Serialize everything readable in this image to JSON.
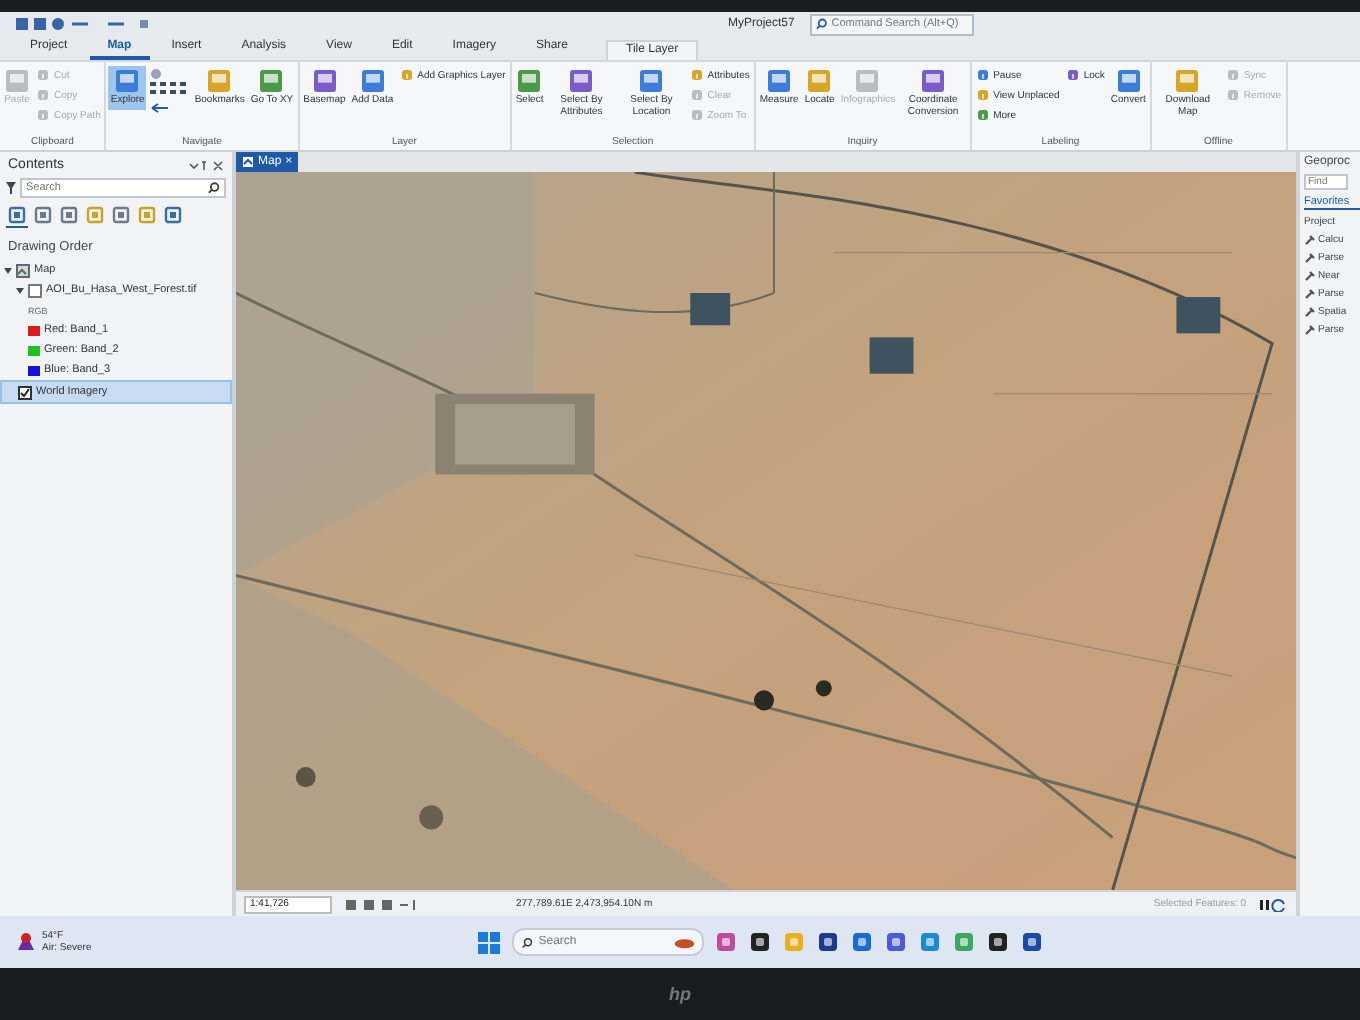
{
  "title_bar": {
    "project": "MyProject57",
    "search": {
      "placeholder": "Command Search (Alt+Q)"
    }
  },
  "tabs": [
    {
      "label": "Project",
      "selected": false,
      "kind": "file"
    },
    {
      "label": "Map",
      "selected": true,
      "kind": "tab"
    },
    {
      "label": "Insert",
      "selected": false,
      "kind": "tab"
    },
    {
      "label": "Analysis",
      "selected": false,
      "kind": "tab"
    },
    {
      "label": "View",
      "selected": false,
      "kind": "tab"
    },
    {
      "label": "Edit",
      "selected": false,
      "kind": "tab"
    },
    {
      "label": "Imagery",
      "selected": false,
      "kind": "tab"
    },
    {
      "label": "Share",
      "selected": false,
      "kind": "tab"
    },
    {
      "label": "Tile Layer",
      "selected": false,
      "kind": "context"
    }
  ],
  "ribbon": [
    {
      "label": "Clipboard",
      "items": [
        {
          "kind": "large",
          "label": "Paste",
          "disabled": true,
          "pressed": false
        },
        {
          "kind": "stack",
          "items": [
            {
              "label": "Cut",
              "disabled": true
            },
            {
              "label": "Copy",
              "disabled": true
            },
            {
              "label": "Copy Path",
              "disabled": true
            }
          ]
        }
      ]
    },
    {
      "label": "Navigate",
      "items": [
        {
          "kind": "large",
          "label": "Explore",
          "disabled": false,
          "pressed": true
        },
        {
          "kind": "grid"
        },
        {
          "kind": "large",
          "label": "Bookmarks",
          "disabled": false,
          "pressed": false
        },
        {
          "kind": "large",
          "label": "Go To XY",
          "disabled": false,
          "pressed": false
        }
      ]
    },
    {
      "label": "Layer",
      "items": [
        {
          "kind": "large",
          "label": "Basemap",
          "disabled": false,
          "pressed": false
        },
        {
          "kind": "large",
          "label": "Add Data",
          "disabled": false,
          "pressed": false
        },
        {
          "kind": "stack",
          "items": [
            {
              "label": "Add Graphics Layer",
              "disabled": false
            }
          ]
        }
      ]
    },
    {
      "label": "Selection",
      "items": [
        {
          "kind": "large",
          "label": "Select",
          "disabled": false,
          "pressed": false
        },
        {
          "kind": "large",
          "label": "Select By Attributes",
          "disabled": false,
          "pressed": false
        },
        {
          "kind": "large",
          "label": "Select By Location",
          "disabled": false,
          "pressed": false
        },
        {
          "kind": "stack",
          "items": [
            {
              "label": "Attributes",
              "disabled": false
            },
            {
              "label": "Clear",
              "disabled": true
            },
            {
              "label": "Zoom To",
              "disabled": true
            }
          ]
        }
      ]
    },
    {
      "label": "Inquiry",
      "items": [
        {
          "kind": "large",
          "label": "Measure",
          "disabled": false,
          "pressed": false
        },
        {
          "kind": "large",
          "label": "Locate",
          "disabled": false,
          "pressed": false
        },
        {
          "kind": "large",
          "label": "Infographics",
          "disabled": true,
          "pressed": false
        },
        {
          "kind": "large",
          "label": "Coordinate Conversion",
          "disabled": false,
          "pressed": false
        }
      ]
    },
    {
      "label": "Labeling",
      "items": [
        {
          "kind": "stack",
          "items": [
            {
              "label": "Pause",
              "disabled": false
            },
            {
              "label": "View Unplaced",
              "disabled": false
            },
            {
              "label": "More",
              "disabled": false
            }
          ]
        },
        {
          "kind": "stack",
          "items": [
            {
              "label": "Lock",
              "disabled": false
            }
          ]
        },
        {
          "kind": "large",
          "label": "Convert",
          "disabled": false,
          "pressed": false
        }
      ]
    },
    {
      "label": "Offline",
      "items": [
        {
          "kind": "large",
          "label": "Download Map",
          "disabled": false,
          "pressed": false
        },
        {
          "kind": "stack",
          "items": [
            {
              "label": "Sync",
              "disabled": true
            },
            {
              "label": "Remove",
              "disabled": true
            }
          ]
        }
      ]
    }
  ],
  "contents": {
    "title": "Contents",
    "search": {
      "placeholder": "Search"
    },
    "heading": "Drawing Order",
    "tree": [
      {
        "label": "Map",
        "expanded": true,
        "selected": false,
        "children": [
          {
            "label": "AOI_Bu_Hasa_West_Forest.tif",
            "checked": false,
            "expanded": true,
            "selected": false,
            "children": [
              {
                "label": "RGB",
                "kind": "heading",
                "selected": false
              },
              {
                "label": "Red: Band_1",
                "kind": "band",
                "color": "#e01b1b",
                "selected": false
              },
              {
                "label": "Green: Band_2",
                "kind": "band",
                "color": "#1fc21f",
                "selected": false
              },
              {
                "label": "Blue: Band_3",
                "kind": "band",
                "color": "#1414d8",
                "selected": false
              }
            ]
          },
          {
            "label": "World Imagery",
            "checked": true,
            "selected": true
          }
        ]
      }
    ]
  },
  "map_tab": {
    "label": "Map",
    "close": "×"
  },
  "status_bar": {
    "scale": "1:41,726",
    "coordinates": "277,789.61E 2,473,954.10N m",
    "selected_features": "Selected Features: 0"
  },
  "geoprocessing": {
    "title": "Geoproc",
    "search": {
      "placeholder": "Find"
    },
    "tab": "Favorites",
    "section": "Project",
    "tools": [
      "Calcu",
      "Parse",
      "Near",
      "Parse",
      "Spatia",
      "Parse"
    ]
  },
  "taskbar": {
    "weather": {
      "temperature": "54°F",
      "condition": "Air: Severe"
    },
    "search": {
      "placeholder": "Search"
    }
  },
  "bezel_logo": "hp"
}
